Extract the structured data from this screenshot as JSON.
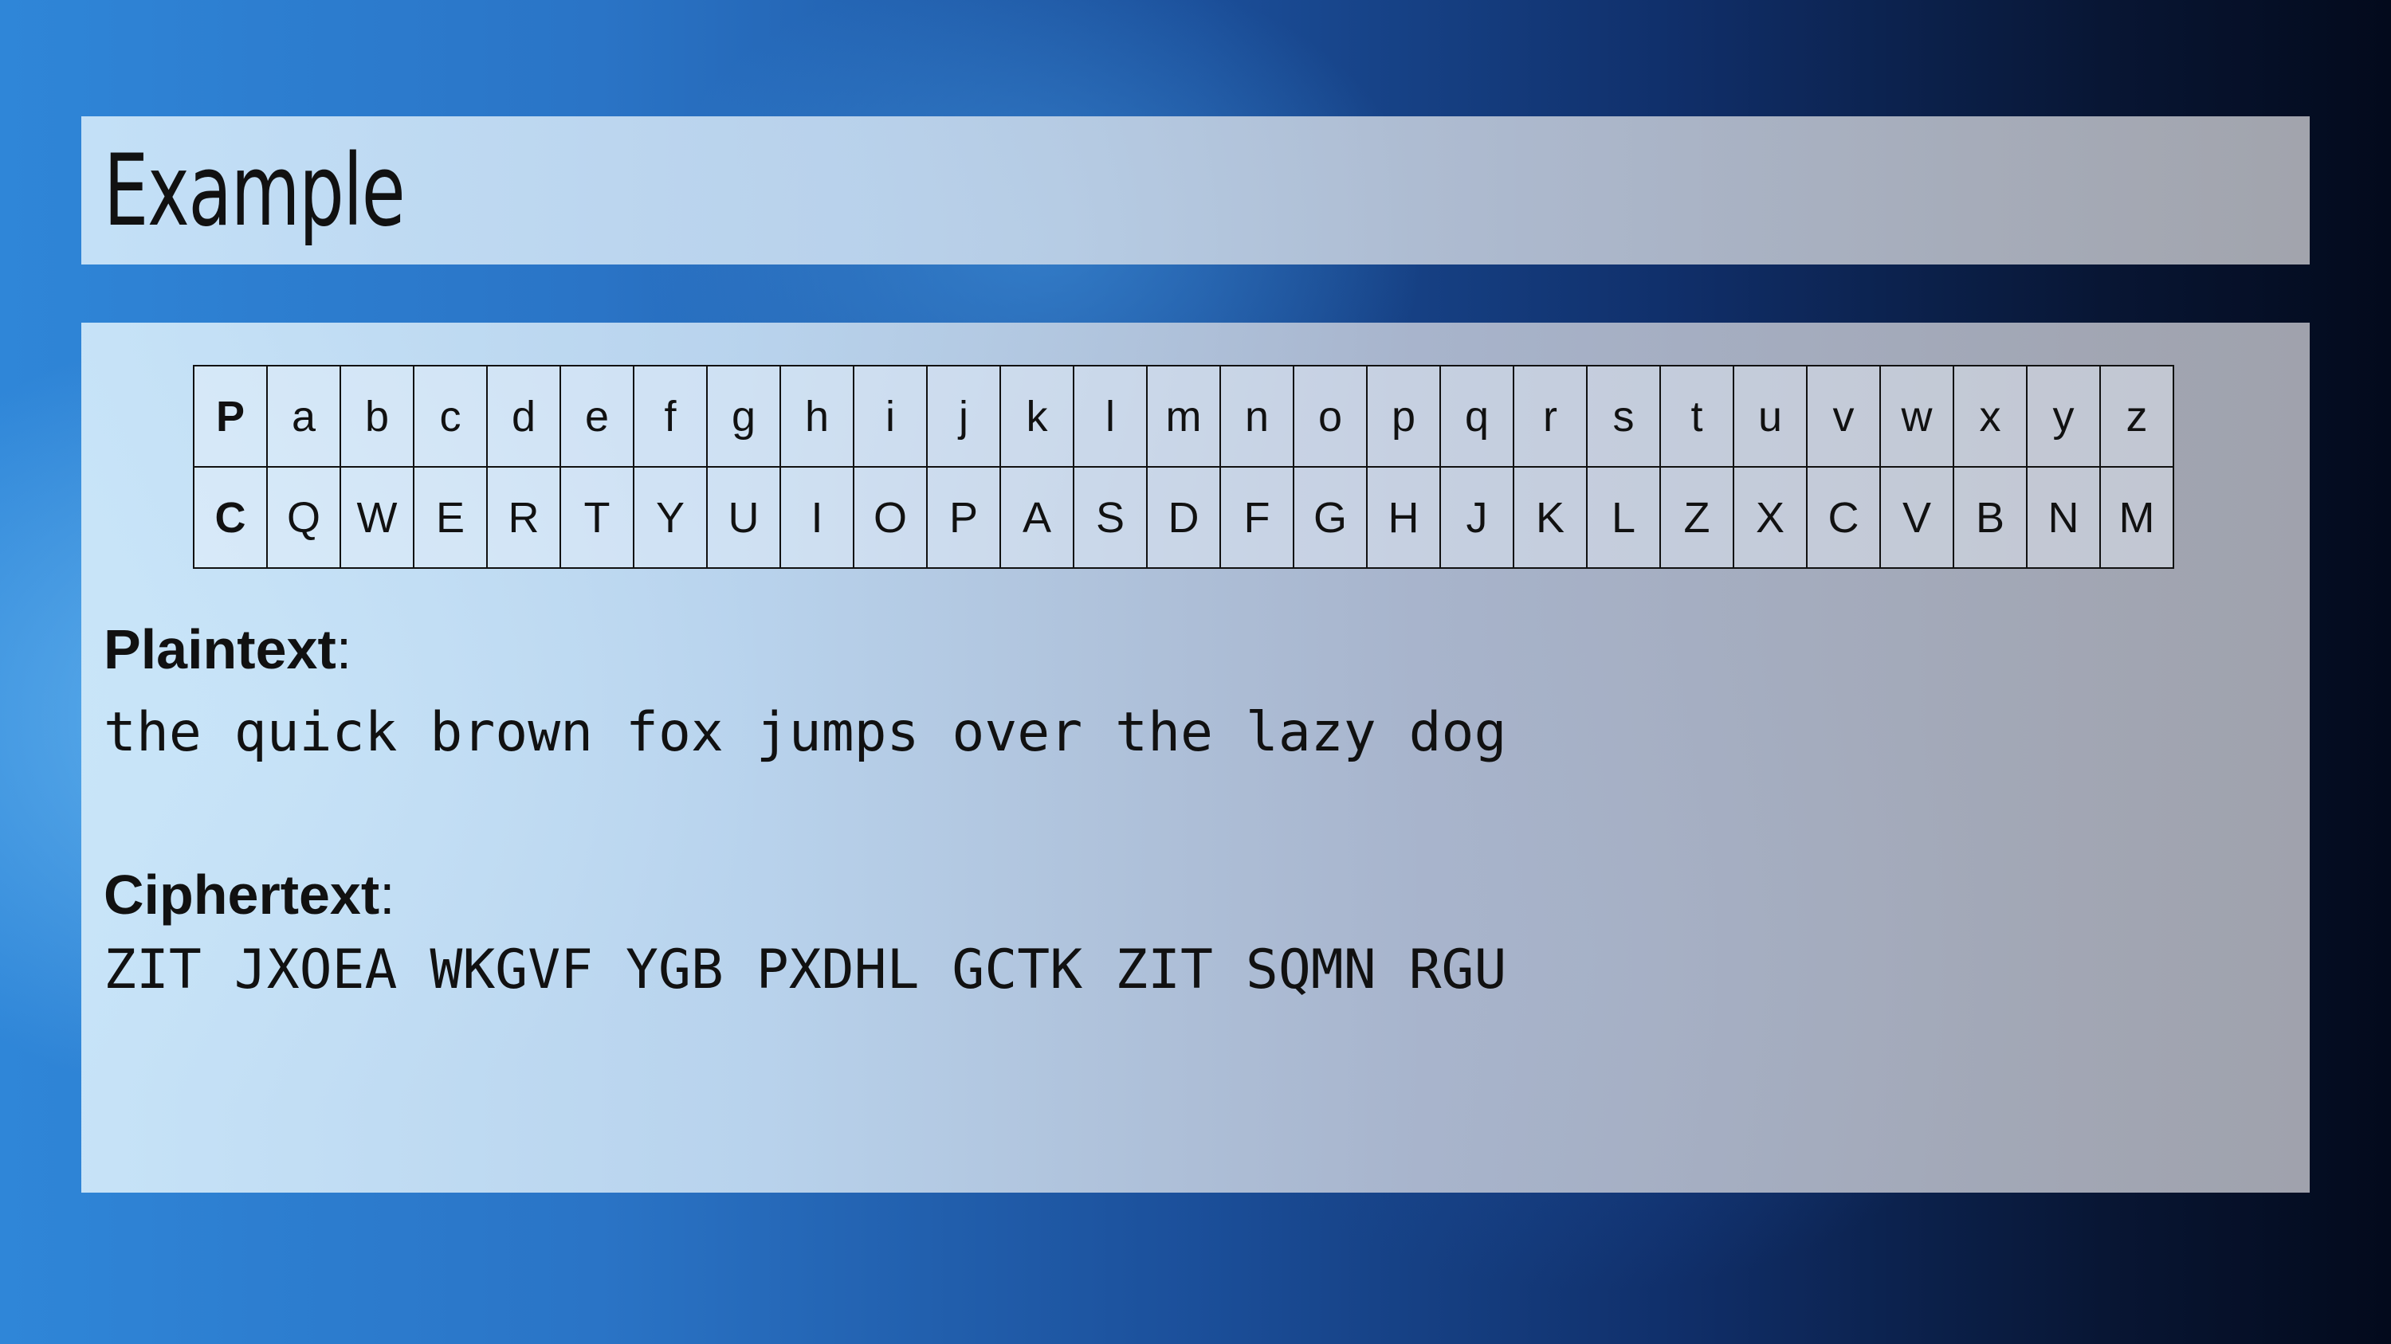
{
  "slide": {
    "title": "Example"
  },
  "cipher_table": {
    "plain_header": "P",
    "cipher_header": "C",
    "plain": [
      "a",
      "b",
      "c",
      "d",
      "e",
      "f",
      "g",
      "h",
      "i",
      "j",
      "k",
      "l",
      "m",
      "n",
      "o",
      "p",
      "q",
      "r",
      "s",
      "t",
      "u",
      "v",
      "w",
      "x",
      "y",
      "z"
    ],
    "cipher": [
      "Q",
      "W",
      "E",
      "R",
      "T",
      "Y",
      "U",
      "I",
      "O",
      "P",
      "A",
      "S",
      "D",
      "F",
      "G",
      "H",
      "J",
      "K",
      "L",
      "Z",
      "X",
      "C",
      "V",
      "B",
      "N",
      "M"
    ]
  },
  "plaintext": {
    "label": "Plaintext",
    "colon": ":",
    "value": "the quick brown fox jumps over the lazy dog"
  },
  "ciphertext": {
    "label": "Ciphertext",
    "colon": ":",
    "value": "ZIT JXOEA WKGVF YGB PXDHL GCTK ZIT SQMN RGU"
  }
}
